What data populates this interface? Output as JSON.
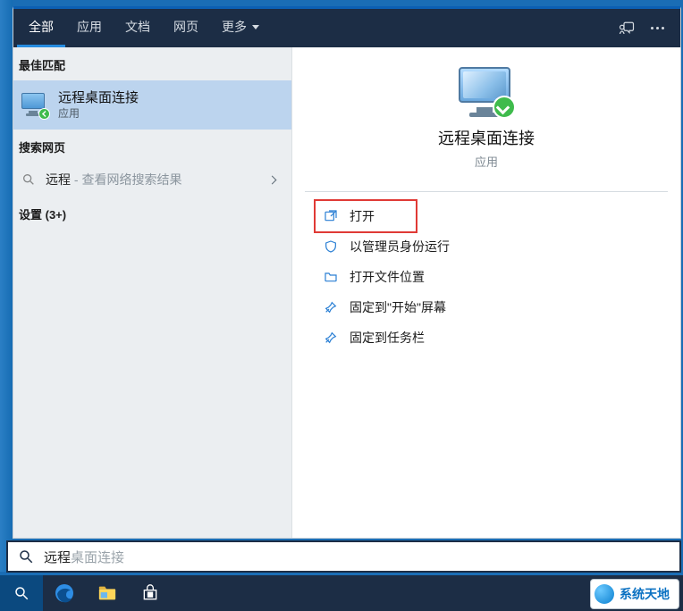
{
  "tabs": {
    "all": "全部",
    "apps": "应用",
    "docs": "文档",
    "web": "网页",
    "more": "更多"
  },
  "sections": {
    "best_match": "最佳匹配",
    "search_web": "搜索网页",
    "settings": "设置 (3+)"
  },
  "best_match_item": {
    "title": "远程桌面连接",
    "subtitle": "应用"
  },
  "web_item": {
    "query": "远程",
    "suffix": " - 查看网络搜索结果"
  },
  "preview": {
    "title": "远程桌面连接",
    "subtitle": "应用"
  },
  "actions": {
    "open": "打开",
    "run_as_admin": "以管理员身份运行",
    "open_file_location": "打开文件位置",
    "pin_to_start": "固定到\"开始\"屏幕",
    "pin_to_taskbar": "固定到任务栏"
  },
  "search_box": {
    "value": "远程",
    "placeholder": "桌面连接"
  },
  "watermark": "系统天地"
}
